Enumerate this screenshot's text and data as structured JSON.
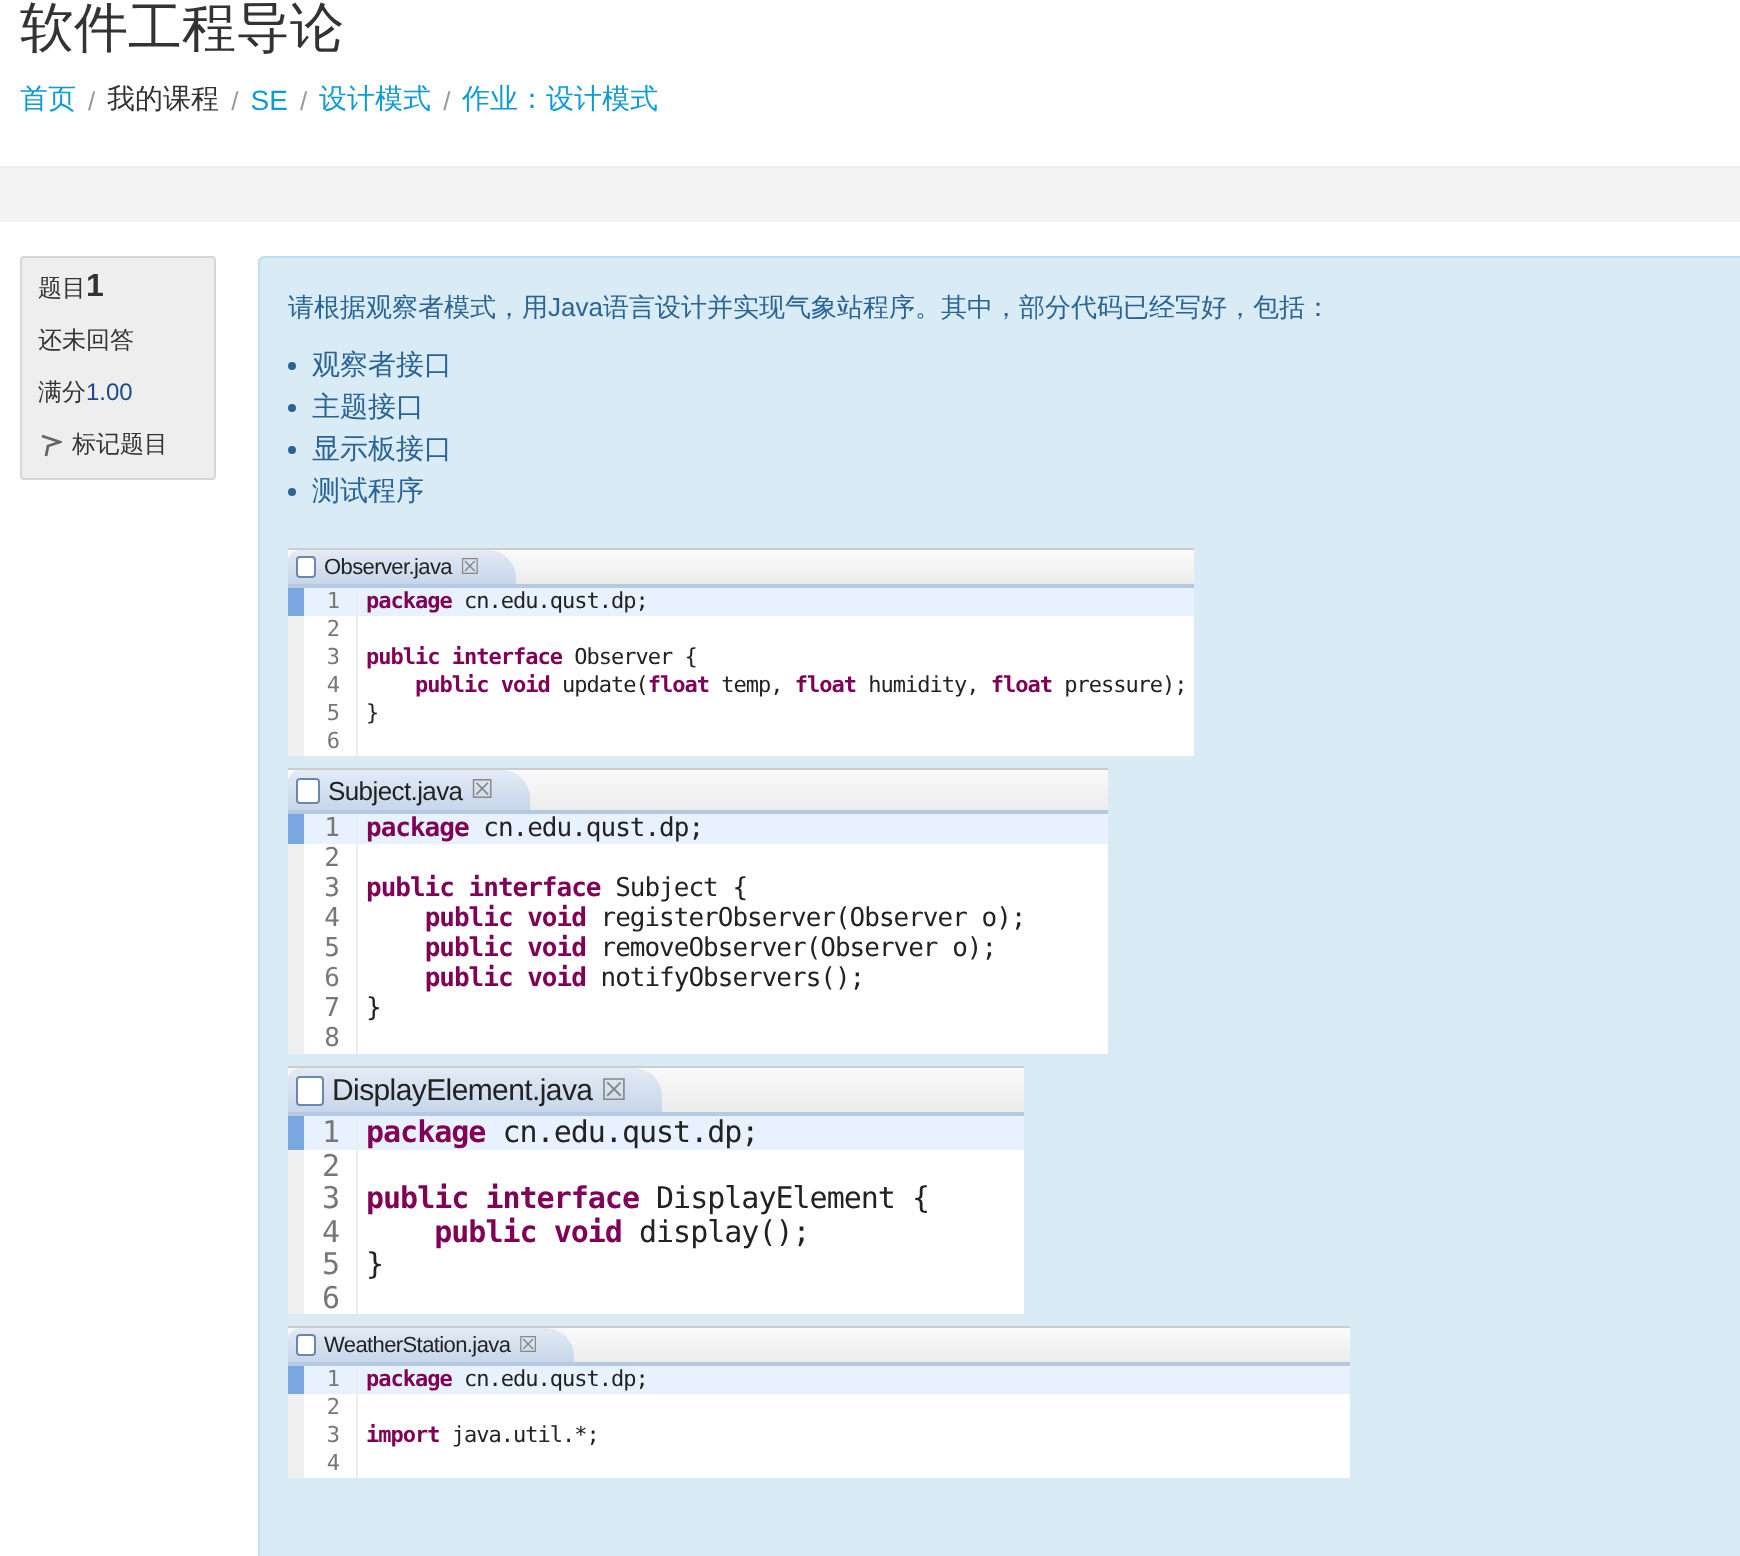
{
  "page_title": "软件工程导论",
  "breadcrumb": [
    {
      "label": "首页",
      "kind": "link"
    },
    {
      "label": "我的课程",
      "kind": "text"
    },
    {
      "label": "SE",
      "kind": "link"
    },
    {
      "label": "设计模式",
      "kind": "link"
    },
    {
      "label": "作业：设计模式",
      "kind": "link"
    }
  ],
  "breadcrumb_separator": "/",
  "question_info": {
    "label": "题目",
    "number": "1",
    "status": "还未回答",
    "mark_label": "满分",
    "mark": "1.00",
    "flag": "标记题目"
  },
  "question": {
    "text": "请根据观察者模式，用Java语言设计并实现气象站程序。其中，部分代码已经写好，包括：",
    "items": [
      "观察者接口",
      "主题接口",
      "显示板接口",
      "测试程序"
    ],
    "code_files": [
      {
        "tab": "Observer.java",
        "close": "☒",
        "lines": [
          {
            "n": "1",
            "code": "**package** cn.edu.qust.dp;",
            "current": true
          },
          {
            "n": "2",
            "current": false
          },
          {
            "n": "3",
            "code": "**public** **interface** Observer {",
            "current": false
          },
          {
            "n": "4",
            "code": "    **public** **void** update(**float** temp, **float** humidity, **float** pressure);",
            "current": false
          },
          {
            "n": "5",
            "code": "}",
            "current": false
          },
          {
            "n": "6",
            "current": false
          }
        ]
      },
      {
        "tab": "Subject.java",
        "close": "☒",
        "lines": [
          {
            "n": "1",
            "code": "**package** cn.edu.qust.dp;",
            "current": true
          },
          {
            "n": "2",
            "current": false
          },
          {
            "n": "3",
            "code": "**public** **interface** Subject {",
            "current": false
          },
          {
            "n": "4",
            "code": "    **public** **void** registerObserver(Observer o);",
            "current": false
          },
          {
            "n": "5",
            "code": "    **public** **void** removeObserver(Observer o);",
            "current": false
          },
          {
            "n": "6",
            "code": "    **public** **void** notifyObservers();",
            "current": false
          },
          {
            "n": "7",
            "code": "}",
            "current": false
          },
          {
            "n": "8",
            "current": false
          }
        ]
      },
      {
        "tab": "DisplayElement.java",
        "close": "☒",
        "lines": [
          {
            "n": "1",
            "code": "**package** cn.edu.qust.dp;",
            "current": true
          },
          {
            "n": "2",
            "current": false
          },
          {
            "n": "3",
            "code": "**public** **interface** DisplayElement {",
            "current": false
          },
          {
            "n": "4",
            "code": "    **public** **void** display();",
            "current": false
          },
          {
            "n": "5",
            "code": "}",
            "current": false
          },
          {
            "n": "6",
            "current": false
          }
        ]
      },
      {
        "tab": "WeatherStation.java",
        "close": "☒",
        "lines": [
          {
            "n": "1",
            "code": "**package** cn.edu.qust.dp;",
            "current": true
          },
          {
            "n": "2",
            "current": false
          },
          {
            "n": "3",
            "code": "**import** java.util.*;",
            "current": false
          },
          {
            "n": "4",
            "current": false
          }
        ]
      }
    ]
  }
}
